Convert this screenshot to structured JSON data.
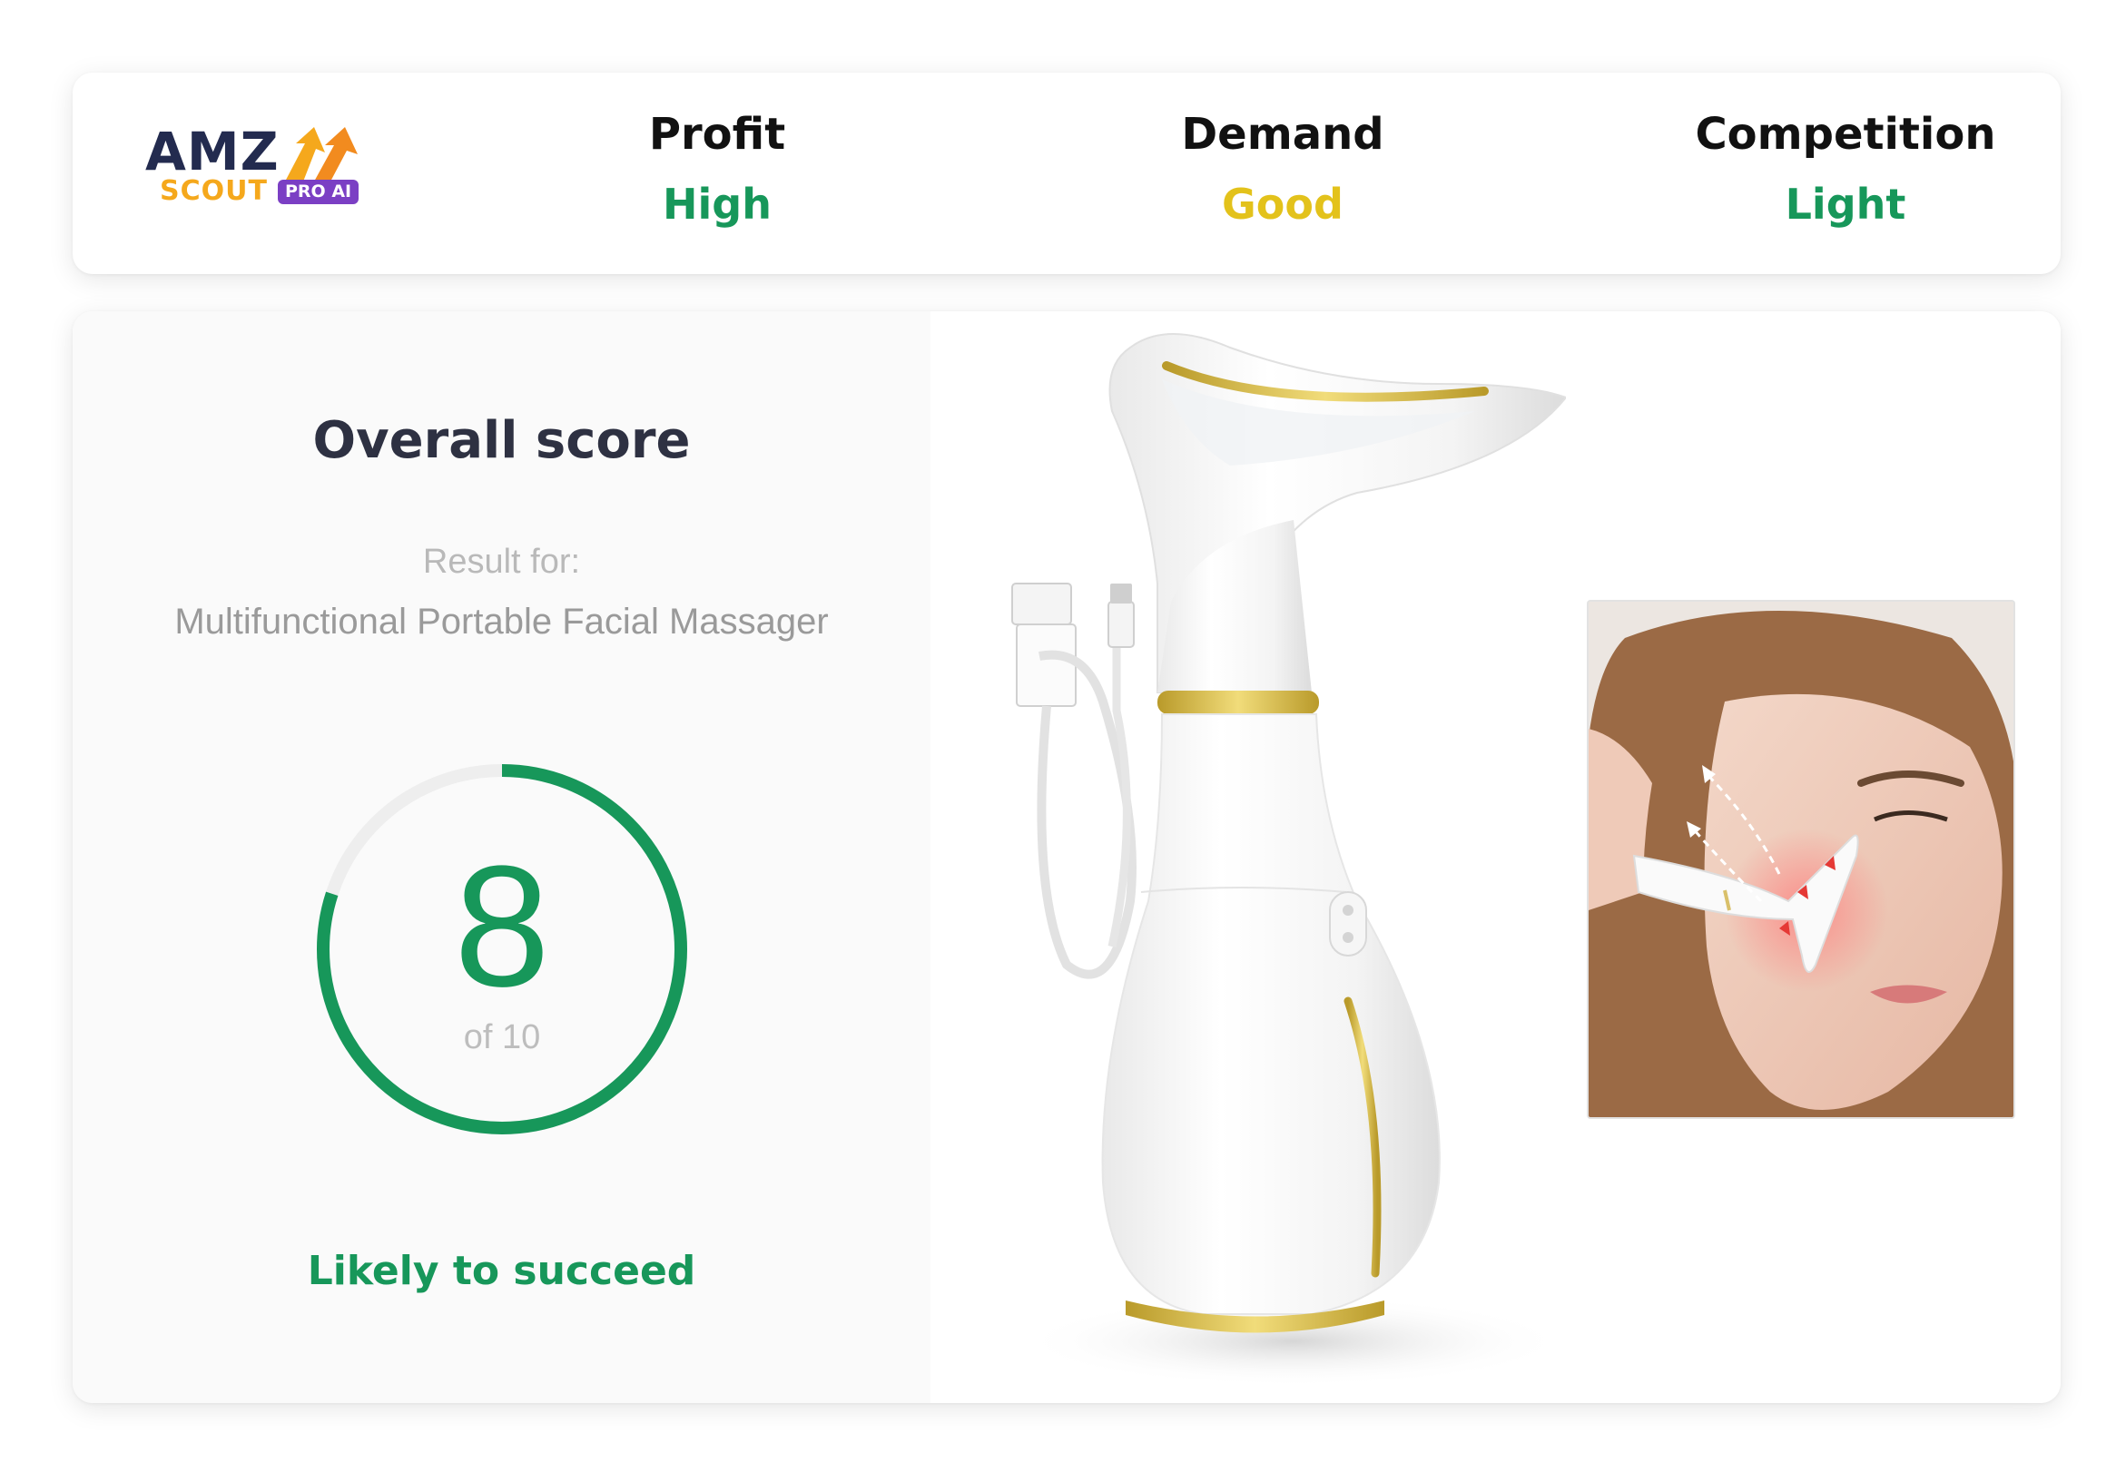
{
  "header": {
    "logo": {
      "amz": "AMZ",
      "scout": "SCOUT",
      "badge": "PRO AI"
    },
    "metrics": [
      {
        "title": "Profit",
        "value": "High",
        "color": "#17975a"
      },
      {
        "title": "Demand",
        "value": "Good",
        "color": "#e3c21b"
      },
      {
        "title": "Competition",
        "value": "Light",
        "color": "#17975a"
      }
    ]
  },
  "score": {
    "title": "Overall score",
    "result_label": "Result for:",
    "product_name": "Multifunctional Portable Facial Massager",
    "value": "8",
    "out_of": "of 10",
    "progress_fraction": 0.8,
    "verdict": "Likely to succeed",
    "accent_color": "#17975a"
  },
  "images": {
    "product": "facial-massager-product-image",
    "inset": "model-using-massager-photo"
  }
}
